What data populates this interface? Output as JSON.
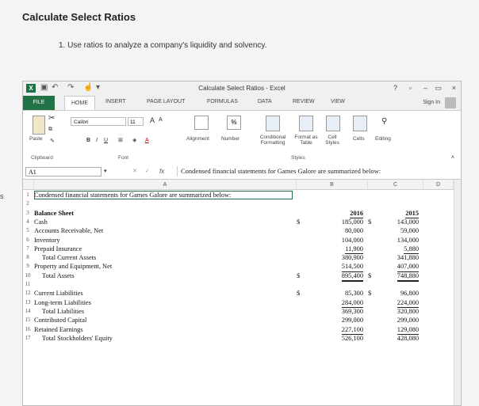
{
  "page": {
    "heading": "Calculate Select Ratios",
    "instruction": "1. Use ratios to analyze a company's liquidity and solvency.",
    "left_fragment": "s"
  },
  "window": {
    "title": "Calculate Select Ratios - Excel",
    "help": "?",
    "minimize": "–",
    "restore": "▫",
    "close": "×",
    "sign_in": "Sign In"
  },
  "tabs": [
    "FILE",
    "HOME",
    "INSERT",
    "PAGE LAYOUT",
    "FORMULAS",
    "DATA",
    "REVIEW",
    "VIEW"
  ],
  "ribbon": {
    "paste": "Paste",
    "clipboard": "Clipboard",
    "font_name": "Calibri",
    "font_size": "11",
    "grow": "A",
    "shrink": "A",
    "bold": "B",
    "italic": "I",
    "underline": "U",
    "font_color": "A",
    "font_group": "Font",
    "percent": "%",
    "alignment": "Alignment",
    "number": "Number",
    "conditional_formatting": "Conditional Formatting",
    "format_as_table": "Format as Table",
    "cell_styles": "Cell Styles",
    "styles_group": "Styles",
    "cells": "Cells",
    "editing": "Editing"
  },
  "formula_bar": {
    "name_box": "A1",
    "fx": "fx",
    "content": "Condensed financial statements for Games Galore are summarized below:"
  },
  "columns": [
    "A",
    "B",
    "C",
    "D"
  ],
  "rows": [
    {
      "n": "1",
      "a": "Condensed financial statements for Games Galore are summarized below:",
      "b_sym": "",
      "b": "",
      "c_sym": "",
      "c": "",
      "bold": false,
      "indent": false,
      "style": ""
    },
    {
      "n": "2",
      "a": "",
      "b_sym": "",
      "b": "",
      "c_sym": "",
      "c": "",
      "bold": false,
      "indent": false,
      "style": ""
    },
    {
      "n": "3",
      "a": "Balance Sheet",
      "b_sym": "",
      "b": "2016",
      "c_sym": "",
      "c": "2015",
      "bold": true,
      "indent": false,
      "style": "uline"
    },
    {
      "n": "4",
      "a": "Cash",
      "b_sym": "$",
      "b": "185,000",
      "c_sym": "$",
      "c": "143,000",
      "bold": false,
      "indent": false,
      "style": ""
    },
    {
      "n": "5",
      "a": "Accounts Receivable, Net",
      "b_sym": "",
      "b": "80,000",
      "c_sym": "",
      "c": "59,000",
      "bold": false,
      "indent": false,
      "style": ""
    },
    {
      "n": "6",
      "a": "Inventory",
      "b_sym": "",
      "b": "104,000",
      "c_sym": "",
      "c": "134,000",
      "bold": false,
      "indent": false,
      "style": ""
    },
    {
      "n": "7",
      "a": "Prepaid Insurance",
      "b_sym": "",
      "b": "11,900",
      "c_sym": "",
      "c": "5,880",
      "bold": false,
      "indent": false,
      "style": "uline"
    },
    {
      "n": "8",
      "a": "Total Current Assets",
      "b_sym": "",
      "b": "380,900",
      "c_sym": "",
      "c": "341,880",
      "bold": false,
      "indent": true,
      "style": ""
    },
    {
      "n": "9",
      "a": "Property and Equipment, Net",
      "b_sym": "",
      "b": "514,500",
      "c_sym": "",
      "c": "407,000",
      "bold": false,
      "indent": false,
      "style": "uline"
    },
    {
      "n": "10",
      "a": "Total Assets",
      "b_sym": "$",
      "b": "895,400",
      "c_sym": "$",
      "c": "748,880",
      "bold": false,
      "indent": true,
      "style": "dline"
    },
    {
      "n": "11",
      "a": "",
      "b_sym": "",
      "b": "",
      "c_sym": "",
      "c": "",
      "bold": false,
      "indent": false,
      "style": ""
    },
    {
      "n": "12",
      "a": "Current Liabilities",
      "b_sym": "$",
      "b": "85,300",
      "c_sym": "$",
      "c": "96,800",
      "bold": false,
      "indent": false,
      "style": ""
    },
    {
      "n": "13",
      "a": "Long-term Liabilities",
      "b_sym": "",
      "b": "284,000",
      "c_sym": "",
      "c": "224,000",
      "bold": false,
      "indent": false,
      "style": "uline"
    },
    {
      "n": "14",
      "a": "Total Liabilities",
      "b_sym": "",
      "b": "369,300",
      "c_sym": "",
      "c": "320,800",
      "bold": false,
      "indent": true,
      "style": ""
    },
    {
      "n": "15",
      "a": "Contributed Capital",
      "b_sym": "",
      "b": "299,000",
      "c_sym": "",
      "c": "299,000",
      "bold": false,
      "indent": false,
      "style": ""
    },
    {
      "n": "16",
      "a": "Retained Earnings",
      "b_sym": "",
      "b": "227,100",
      "c_sym": "",
      "c": "129,080",
      "bold": false,
      "indent": false,
      "style": "uline"
    },
    {
      "n": "17",
      "a": "Total Stockholders' Equity",
      "b_sym": "",
      "b": "526,100",
      "c_sym": "",
      "c": "428,080",
      "bold": false,
      "indent": true,
      "style": ""
    }
  ]
}
